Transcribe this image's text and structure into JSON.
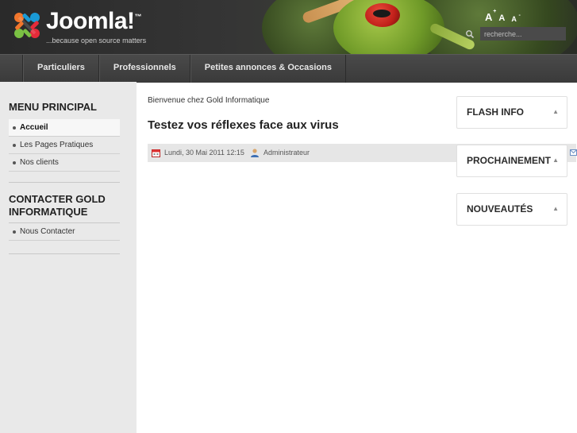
{
  "header": {
    "logo_text": "Joomla!",
    "logo_tm": "™",
    "tagline": "...because open source matters",
    "font_tools": {
      "increase": "A",
      "increase_sup": "+",
      "reset": "A",
      "decrease": "A",
      "decrease_sup": "-"
    },
    "search": {
      "placeholder": "recherche..."
    }
  },
  "nav": {
    "items": [
      {
        "label": "Particuliers"
      },
      {
        "label": "Professionnels"
      },
      {
        "label": "Petites annonces & Occasions"
      }
    ]
  },
  "sidebar": {
    "menu_principal": {
      "title": "MENU PRINCIPAL",
      "items": [
        {
          "label": "Accueil",
          "active": true
        },
        {
          "label": "Les Pages Pratiques"
        },
        {
          "label": "Nos clients"
        }
      ]
    },
    "contacter": {
      "title": "CONTACTER GOLD INFORMATIQUE",
      "items": [
        {
          "label": "Nous Contacter"
        }
      ]
    }
  },
  "main": {
    "breadcrumb": "Bienvenue chez Gold Informatique",
    "article": {
      "title": "Testez vos réflexes face aux virus",
      "date": "Lundi, 30 Mai 2011 12:15",
      "author": "Administrateur"
    }
  },
  "modules": {
    "flash_info": {
      "title": "FLASH INFO",
      "toggle": "▲"
    },
    "prochainement": {
      "title": "PROCHAINEMENT",
      "toggle": "▲"
    },
    "nouveautes": {
      "title": "NOUVEAUTÉS",
      "toggle": "▲"
    }
  },
  "colors": {
    "header_bg": "#2f2f2f",
    "nav_bg": "#404040",
    "sidebar_bg": "#e9e9e9",
    "meta_bar_bg": "#e6e6e6"
  }
}
